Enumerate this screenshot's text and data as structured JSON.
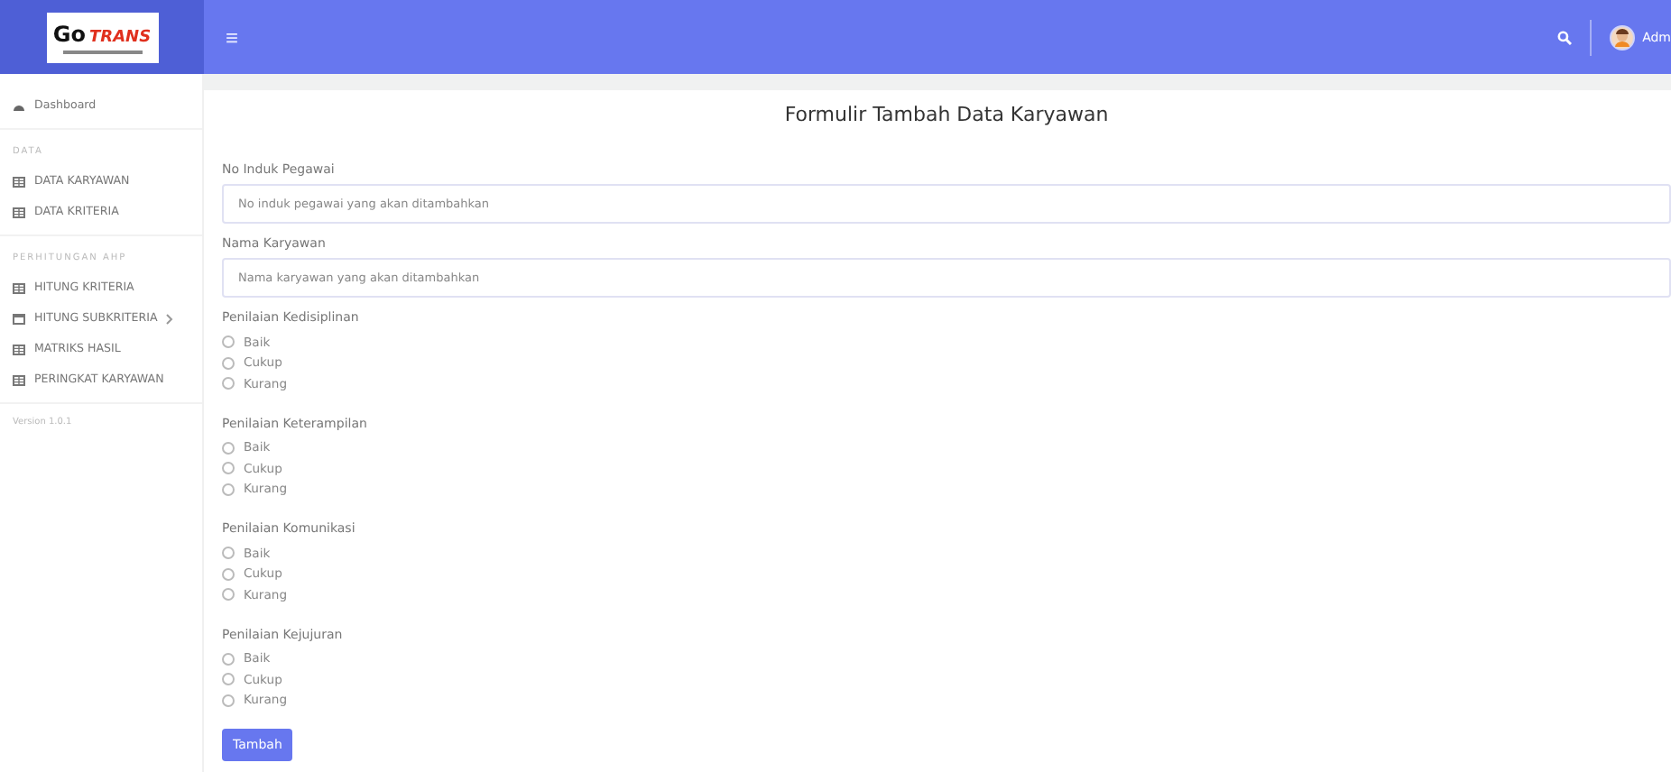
{
  "brand": {
    "word_1": "Go",
    "word_2": "TRANS"
  },
  "topbar": {
    "menu_glyph": "≡",
    "user": "Adm"
  },
  "sidebar": {
    "sections": [
      {
        "items": [
          {
            "label": "Dashboard",
            "kind": "dashboard",
            "submenu": false
          }
        ]
      },
      {
        "heading": "DATA",
        "items": [
          {
            "label": "DATA KARYAWAN",
            "kind": "table",
            "submenu": false
          },
          {
            "label": "DATA KRITERIA",
            "kind": "table",
            "submenu": false
          }
        ]
      },
      {
        "heading": "PERHITUNGAN AHP",
        "items": [
          {
            "label": "HITUNG KRITERIA",
            "kind": "table",
            "submenu": false
          },
          {
            "label": "HITUNG SUBKRITERIA",
            "kind": "window",
            "submenu": true
          },
          {
            "label": "MATRIKS HASIL",
            "kind": "table",
            "submenu": false
          },
          {
            "label": "PERINGKAT KARYAWAN",
            "kind": "table",
            "submenu": false
          }
        ]
      }
    ],
    "version": "Version 1.0.1"
  },
  "form": {
    "title": "Formulir Tambah Data Karyawan",
    "fields": [
      {
        "label": "No Induk Pegawai",
        "placeholder": "No induk pegawai yang akan ditambahkan"
      },
      {
        "label": "Nama Karyawan",
        "placeholder": "Nama karyawan yang akan ditambahkan"
      }
    ],
    "ratings": [
      {
        "label": "Penilaian Kedisiplinan",
        "options": [
          {
            "label": "Baik",
            "selected": false
          },
          {
            "label": "Cukup",
            "selected": false
          },
          {
            "label": "Kurang",
            "selected": false
          }
        ]
      },
      {
        "label": "Penilaian Keterampilan",
        "options": [
          {
            "label": "Baik",
            "selected": false
          },
          {
            "label": "Cukup",
            "selected": false
          },
          {
            "label": "Kurang",
            "selected": false
          }
        ]
      },
      {
        "label": "Penilaian Komunikasi",
        "options": [
          {
            "label": "Baik",
            "selected": false
          },
          {
            "label": "Cukup",
            "selected": false
          },
          {
            "label": "Kurang",
            "selected": false
          }
        ]
      },
      {
        "label": "Penilaian Kejujuran",
        "options": [
          {
            "label": "Baik",
            "selected": false
          },
          {
            "label": "Cukup",
            "selected": false
          },
          {
            "label": "Kurang",
            "selected": false
          }
        ]
      }
    ],
    "submit": "Tambah"
  }
}
